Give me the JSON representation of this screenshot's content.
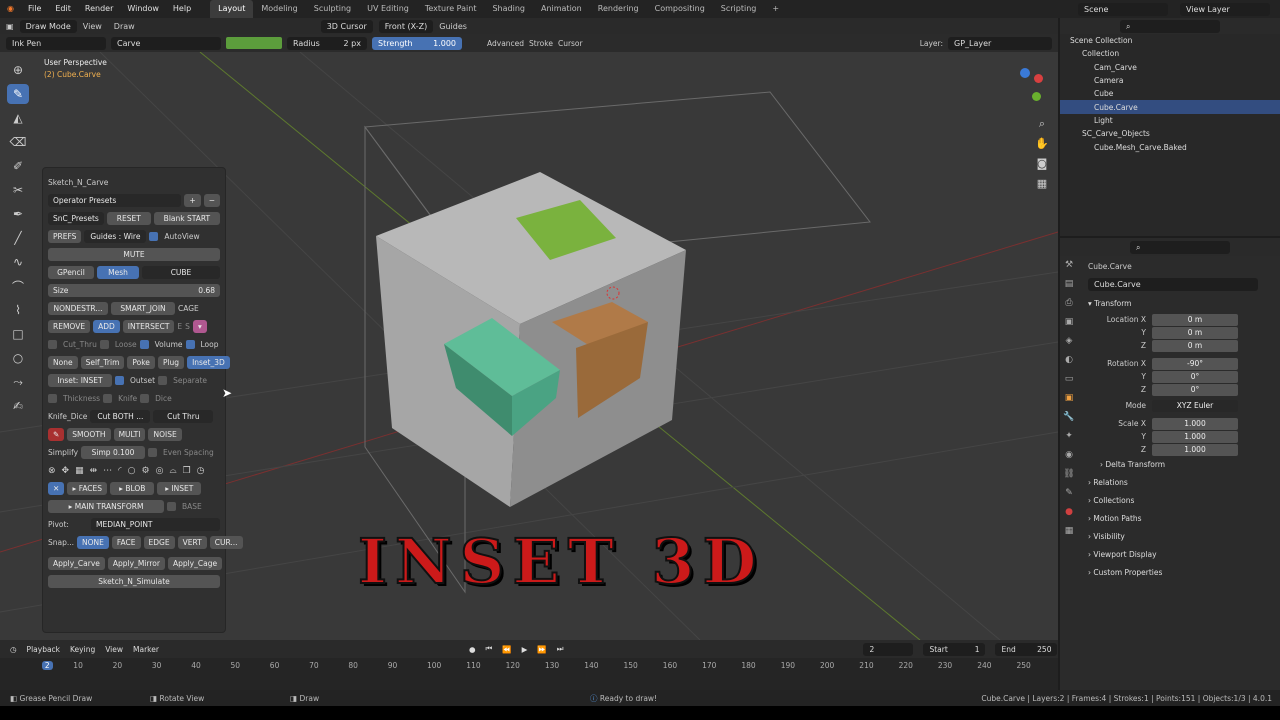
{
  "menu": [
    "File",
    "Edit",
    "Render",
    "Window",
    "Help"
  ],
  "workspaces": [
    "Layout",
    "Modeling",
    "Sculpting",
    "UV Editing",
    "Texture Paint",
    "Shading",
    "Animation",
    "Rendering",
    "Compositing",
    "Scripting",
    "+"
  ],
  "scene": "Scene",
  "viewlayer": "View Layer",
  "header": {
    "mode": "Draw Mode",
    "view": "View",
    "draw": "Draw",
    "cursor": "3D Cursor",
    "front": "Front (X-Z)",
    "guides": "Guides"
  },
  "tool": {
    "brush": "Ink Pen",
    "material": "Carve",
    "radius_label": "Radius",
    "radius": "2 px",
    "strength_label": "Strength",
    "strength": "1.000",
    "advanced": "Advanced",
    "stroke": "Stroke",
    "cursor": "Cursor",
    "layer_label": "Layer:",
    "layer": "GP_Layer"
  },
  "viewport": {
    "perspective": "User Perspective",
    "object": "(2) Cube.Carve"
  },
  "panel": {
    "title": "Sketch_N_Carve",
    "op_presets": "Operator Presets",
    "snc_presets": "SnC_Presets",
    "reset": "RESET",
    "blank": "Blank START",
    "prefs": "PREFS",
    "guides": "Guides : Wire",
    "autoview": "AutoView",
    "mute": "MUTE",
    "gpencil": "GPencil",
    "mesh": "Mesh",
    "cube": "CUBE",
    "size_label": "Size",
    "size": "0.68",
    "nondestr": "NONDESTR...",
    "smart_join": "SMART_JOIN",
    "cage": "CAGE",
    "remove": "REMOVE",
    "add": "ADD",
    "intersect": "INTERSECT",
    "e": "E",
    "s": "S",
    "cut_thru": "Cut_Thru",
    "loose": "Loose",
    "volume": "Volume",
    "loop": "Loop",
    "none": "None",
    "self_trim": "Self_Trim",
    "poke": "Poke",
    "plug": "Plug",
    "inset3d": "Inset_3D",
    "inset_label": "Inset:",
    "inset": "INSET",
    "outset": "Outset",
    "separate": "Separate",
    "thickness": "Thickness",
    "knife": "Knife",
    "dice": "Dice",
    "knife_dice": "Knife_Dice",
    "cut_both": "Cut BOTH ...",
    "cut_thru2": "Cut Thru",
    "smooth": "SMOOTH",
    "multi": "MULTI",
    "noise": "NOISE",
    "simplify": "Simplify",
    "simp": "Simp",
    "simp_val": "0.100",
    "even": "Even Spacing",
    "faces": "FACES",
    "blob": "BLOB",
    "inset_btn": "INSET",
    "main_transform": "MAIN TRANSFORM",
    "base": "BASE",
    "pivot_label": "Pivot:",
    "pivot": "MEDIAN_POINT",
    "snap_label": "Snap...",
    "snap": [
      "NONE",
      "FACE",
      "EDGE",
      "VERT",
      "CUR..."
    ],
    "apply_carve": "Apply_Carve",
    "apply_mirror": "Apply_Mirror",
    "apply_cage": "Apply_Cage",
    "simulate": "Sketch_N_Simulate"
  },
  "outliner": {
    "items": [
      {
        "label": "Scene Collection",
        "indent": 0
      },
      {
        "label": "Collection",
        "indent": 1
      },
      {
        "label": "Cam_Carve",
        "indent": 2
      },
      {
        "label": "Camera",
        "indent": 2
      },
      {
        "label": "Cube",
        "indent": 2
      },
      {
        "label": "Cube.Carve",
        "indent": 2,
        "selected": true
      },
      {
        "label": "Light",
        "indent": 2
      },
      {
        "label": "SC_Carve_Objects",
        "indent": 1
      },
      {
        "label": "Cube.Mesh_Carve.Baked",
        "indent": 2
      }
    ]
  },
  "props": {
    "object": "Cube.Carve",
    "name": "Cube.Carve",
    "transform": "Transform",
    "location_label": "Location X",
    "rotation_label": "Rotation X",
    "scale_label": "Scale X",
    "loc": [
      "0 m",
      "0 m",
      "0 m"
    ],
    "rot": [
      "-90°",
      "0°",
      "0°"
    ],
    "mode_label": "Mode",
    "mode": "XYZ Euler",
    "scale": [
      "1.000",
      "1.000",
      "1.000"
    ],
    "y": "Y",
    "z": "Z",
    "sections": [
      "Delta Transform",
      "Relations",
      "Collections",
      "Motion Paths",
      "Visibility",
      "Viewport Display",
      "Custom Properties"
    ]
  },
  "timeline": {
    "playback": "Playback",
    "keying": "Keying",
    "view": "View",
    "marker": "Marker",
    "frame": "2",
    "start_label": "Start",
    "start": "1",
    "end_label": "End",
    "end": "250",
    "ticks": [
      "2",
      "10",
      "20",
      "30",
      "40",
      "50",
      "60",
      "70",
      "80",
      "90",
      "100",
      "110",
      "120",
      "130",
      "140",
      "150",
      "160",
      "170",
      "180",
      "190",
      "200",
      "210",
      "220",
      "230",
      "240",
      "250"
    ]
  },
  "status": {
    "left": "Grease Pencil Draw",
    "mid": "Rotate View",
    "draw": "Draw",
    "ready": "Ready to draw!",
    "right": "Cube.Carve | Layers:2 | Frames:4 | Strokes:1 | Points:151 | Objects:1/3 | 4.0.1"
  },
  "overlay_title": "INSET 3D"
}
